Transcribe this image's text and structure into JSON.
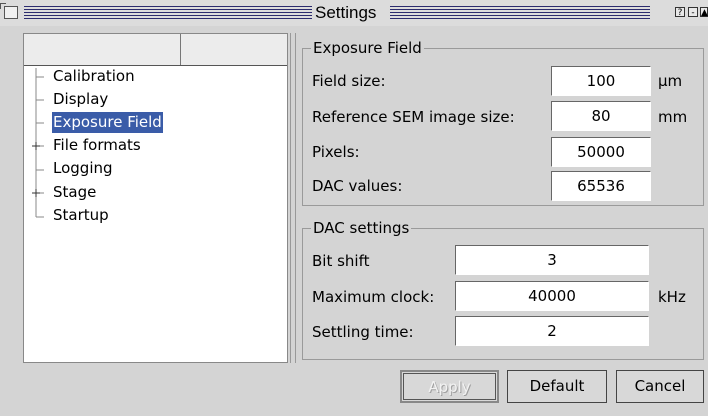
{
  "window": {
    "title": "Settings",
    "buttons": [
      "?",
      "-",
      "▲"
    ]
  },
  "tree": {
    "items": [
      {
        "label": "Calibration",
        "expandable": false,
        "selected": false
      },
      {
        "label": "Display",
        "expandable": false,
        "selected": false
      },
      {
        "label": "Exposure Field",
        "expandable": false,
        "selected": true
      },
      {
        "label": "File formats",
        "expandable": true,
        "selected": false
      },
      {
        "label": "Logging",
        "expandable": false,
        "selected": false
      },
      {
        "label": "Stage",
        "expandable": true,
        "selected": false
      },
      {
        "label": "Startup",
        "expandable": false,
        "selected": false
      }
    ]
  },
  "exposure_field": {
    "title": "Exposure Field",
    "field_size": {
      "label": "Field size:",
      "value": "100",
      "unit": "µm"
    },
    "ref_sem": {
      "label": "Reference SEM image size:",
      "value": "80",
      "unit": "mm"
    },
    "pixels": {
      "label": "Pixels:",
      "value": "50000"
    },
    "dac_values": {
      "label": "DAC values:",
      "value": "65536"
    }
  },
  "dac_settings": {
    "title": "DAC settings",
    "bit_shift": {
      "label": "Bit shift",
      "value": "3"
    },
    "max_clock": {
      "label": "Maximum clock:",
      "value": "40000",
      "unit": "kHz"
    },
    "settling_time": {
      "label": "Settling time:",
      "value": "2"
    }
  },
  "buttons": {
    "apply": "Apply",
    "default": "Default",
    "cancel": "Cancel"
  }
}
